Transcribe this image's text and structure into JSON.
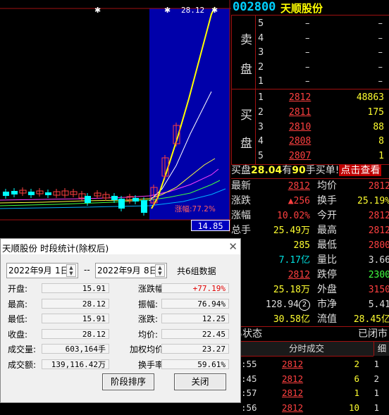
{
  "stock": {
    "code": "002800",
    "name": "天顺股份"
  },
  "chart": {
    "high_label": "28.12",
    "gain_label": "涨幅:77.2%",
    "price_box": "14.85",
    "markers": [
      "✱",
      "✱",
      "✱"
    ]
  },
  "order_book": {
    "sell_side_label": [
      "卖",
      "盘"
    ],
    "buy_side_label": [
      "买",
      "盘"
    ],
    "asks": [
      {
        "level": "5",
        "price": "–",
        "volume": "–"
      },
      {
        "level": "4",
        "price": "–",
        "volume": "–"
      },
      {
        "level": "3",
        "price": "–",
        "volume": "–"
      },
      {
        "level": "2",
        "price": "–",
        "volume": "–"
      },
      {
        "level": "1",
        "price": "–",
        "volume": "–"
      }
    ],
    "bids": [
      {
        "level": "1",
        "price": "2812",
        "volume": "48863"
      },
      {
        "level": "2",
        "price": "2811",
        "volume": "175"
      },
      {
        "level": "3",
        "price": "2810",
        "volume": "88"
      },
      {
        "level": "4",
        "price": "2808",
        "volume": "8"
      },
      {
        "level": "5",
        "price": "2807",
        "volume": "1"
      }
    ]
  },
  "buy_order": {
    "t1": "买盘",
    "v1": "28.04",
    "t2": "有",
    "v2": "90",
    "t3": "手买单!",
    "link": "点击查看"
  },
  "quote": [
    {
      "l1": "最新",
      "v1": "2812",
      "l2": "均价",
      "v2": "2812"
    },
    {
      "l1": "涨跌",
      "v1": "▲256",
      "l2": "换手",
      "v2": "25.19%"
    },
    {
      "l1": "涨幅",
      "v1": "10.02%",
      "l2": "今开",
      "v2": "2812"
    },
    {
      "l1": "总手",
      "v1": "25.49万",
      "l2": "最高",
      "v2": "2812"
    },
    {
      "l1": "手",
      "v1": "285",
      "l2": "最低",
      "v2": "2800"
    },
    {
      "l1": "额",
      "v1": "7.17亿",
      "l2": "量比",
      "v2": "3.66"
    },
    {
      "l1": "停",
      "v1": "2812",
      "l2": "跌停",
      "v2": "2300"
    },
    {
      "l1": "盘",
      "v1": "25.18万",
      "l2": "外盘",
      "v2": "3150"
    },
    {
      "l1": "盈",
      "v1": "128.94",
      "badge": "2",
      "l2": "市净",
      "v2": "5.41"
    },
    {
      "l1": "值",
      "v1": "30.58亿",
      "l2": "流值",
      "v2": "28.45亿"
    }
  ],
  "trade_status": {
    "label": "易状态",
    "value": "已闭市"
  },
  "ticks": {
    "header": "分时成交",
    "tab": "细",
    "rows": [
      {
        "time": ":55",
        "price": "2812",
        "vol": "2",
        "n": "1"
      },
      {
        "time": ":45",
        "price": "2812",
        "vol": "6",
        "n": "2"
      },
      {
        "time": ":57",
        "price": "2812",
        "vol": "1",
        "n": "1"
      },
      {
        "time": ":56",
        "price": "2812",
        "vol": "10",
        "n": "1"
      }
    ]
  },
  "dialog": {
    "title": "天顺股份 时段统计(除权后)",
    "close": "✕",
    "start": {
      "year": "2022年",
      "month": "9月",
      "day": "1日"
    },
    "sep": "--",
    "end": {
      "year": "2022年",
      "month": "9月",
      "day": "8日"
    },
    "count": "共6组数据",
    "fields_left": [
      {
        "label": "开盘:",
        "value": "15.91"
      },
      {
        "label": "最高:",
        "value": "28.12"
      },
      {
        "label": "最低:",
        "value": "15.91"
      },
      {
        "label": "收盘:",
        "value": "28.12"
      },
      {
        "label": "成交量:",
        "value": "603,164手"
      },
      {
        "label": "成交额:",
        "value": "139,116.42万"
      }
    ],
    "fields_right": [
      {
        "label": "涨跌幅:",
        "value": "+77.19%"
      },
      {
        "label": "振幅:",
        "value": "76.94%"
      },
      {
        "label": "涨跌:",
        "value": "12.25"
      },
      {
        "label": "均价:",
        "value": "22.45"
      },
      {
        "label": "加权均价:",
        "value": "23.27"
      },
      {
        "label": "换手率:",
        "value": "59.61%"
      }
    ],
    "btn_sort": "阶段排序",
    "btn_close": "关闭"
  },
  "colors": {
    "up": "#ff4040",
    "down": "#00ffff",
    "highlight": "#0000aa"
  }
}
